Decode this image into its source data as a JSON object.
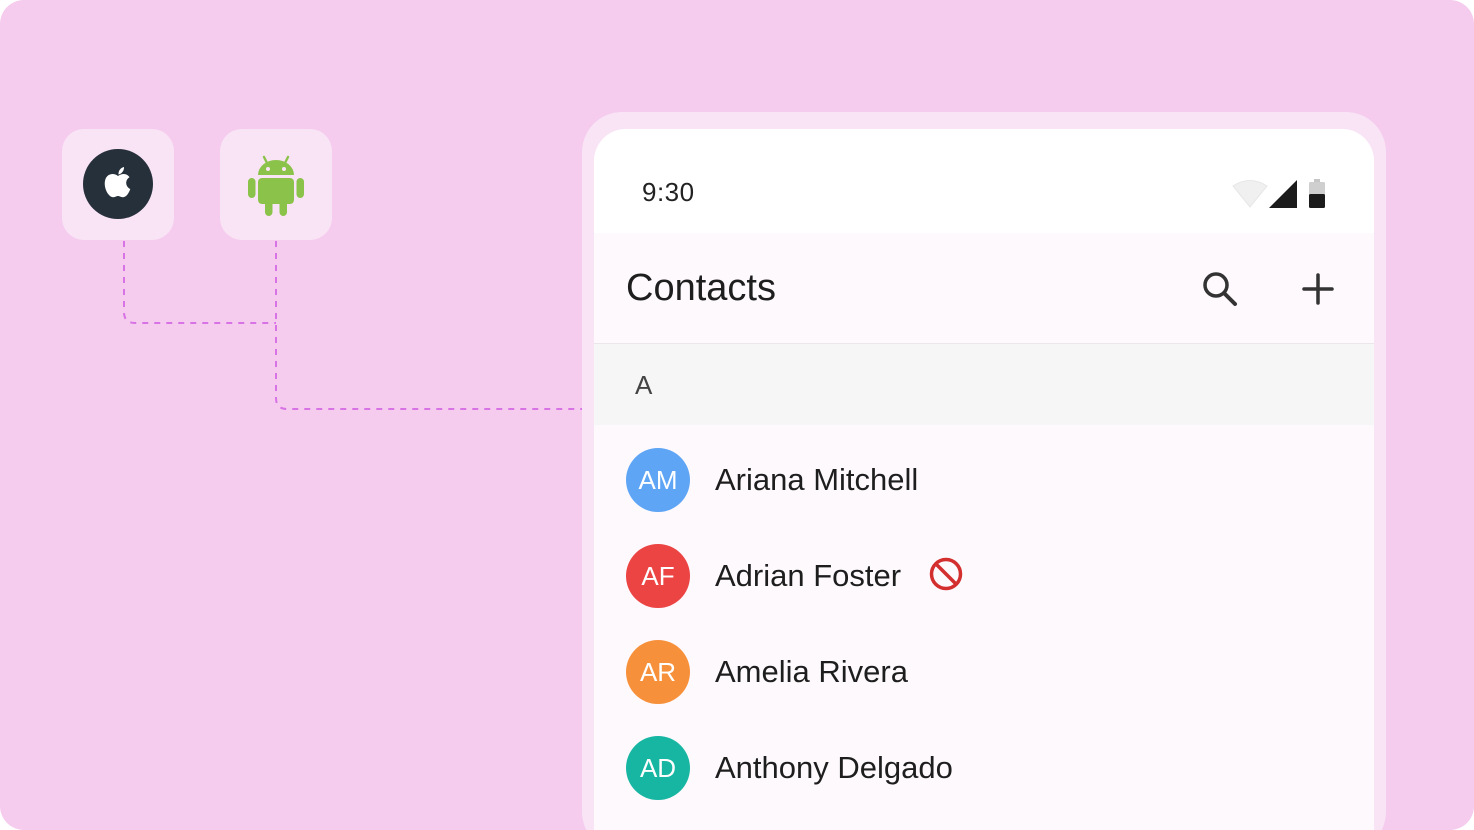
{
  "platforms": [
    {
      "name": "iOS",
      "icon": "apple-icon"
    },
    {
      "name": "Android",
      "icon": "android-icon"
    }
  ],
  "colors": {
    "background": "#f5cbee",
    "tile": "#f9e4f6",
    "connector": "#d873e6",
    "apple_badge": "#26303a",
    "android_green": "#8bc34a",
    "blocked": "#d32f2f"
  },
  "phone": {
    "status_bar": {
      "time": "9:30",
      "icons": [
        "wifi-icon",
        "signal-icon",
        "battery-icon"
      ]
    },
    "app_bar": {
      "title": "Contacts",
      "actions": [
        "search-icon",
        "add-icon"
      ]
    },
    "section": {
      "letter": "A"
    },
    "contacts": [
      {
        "initials": "AM",
        "name": "Ariana Mitchell",
        "avatar_color": "#5fa5f5",
        "blocked": false
      },
      {
        "initials": "AF",
        "name": "Adrian Foster",
        "avatar_color": "#ec4343",
        "blocked": true
      },
      {
        "initials": "AR",
        "name": "Amelia Rivera",
        "avatar_color": "#f7903b",
        "blocked": false
      },
      {
        "initials": "AD",
        "name": "Anthony Delgado",
        "avatar_color": "#17b6a2",
        "blocked": false
      }
    ]
  }
}
